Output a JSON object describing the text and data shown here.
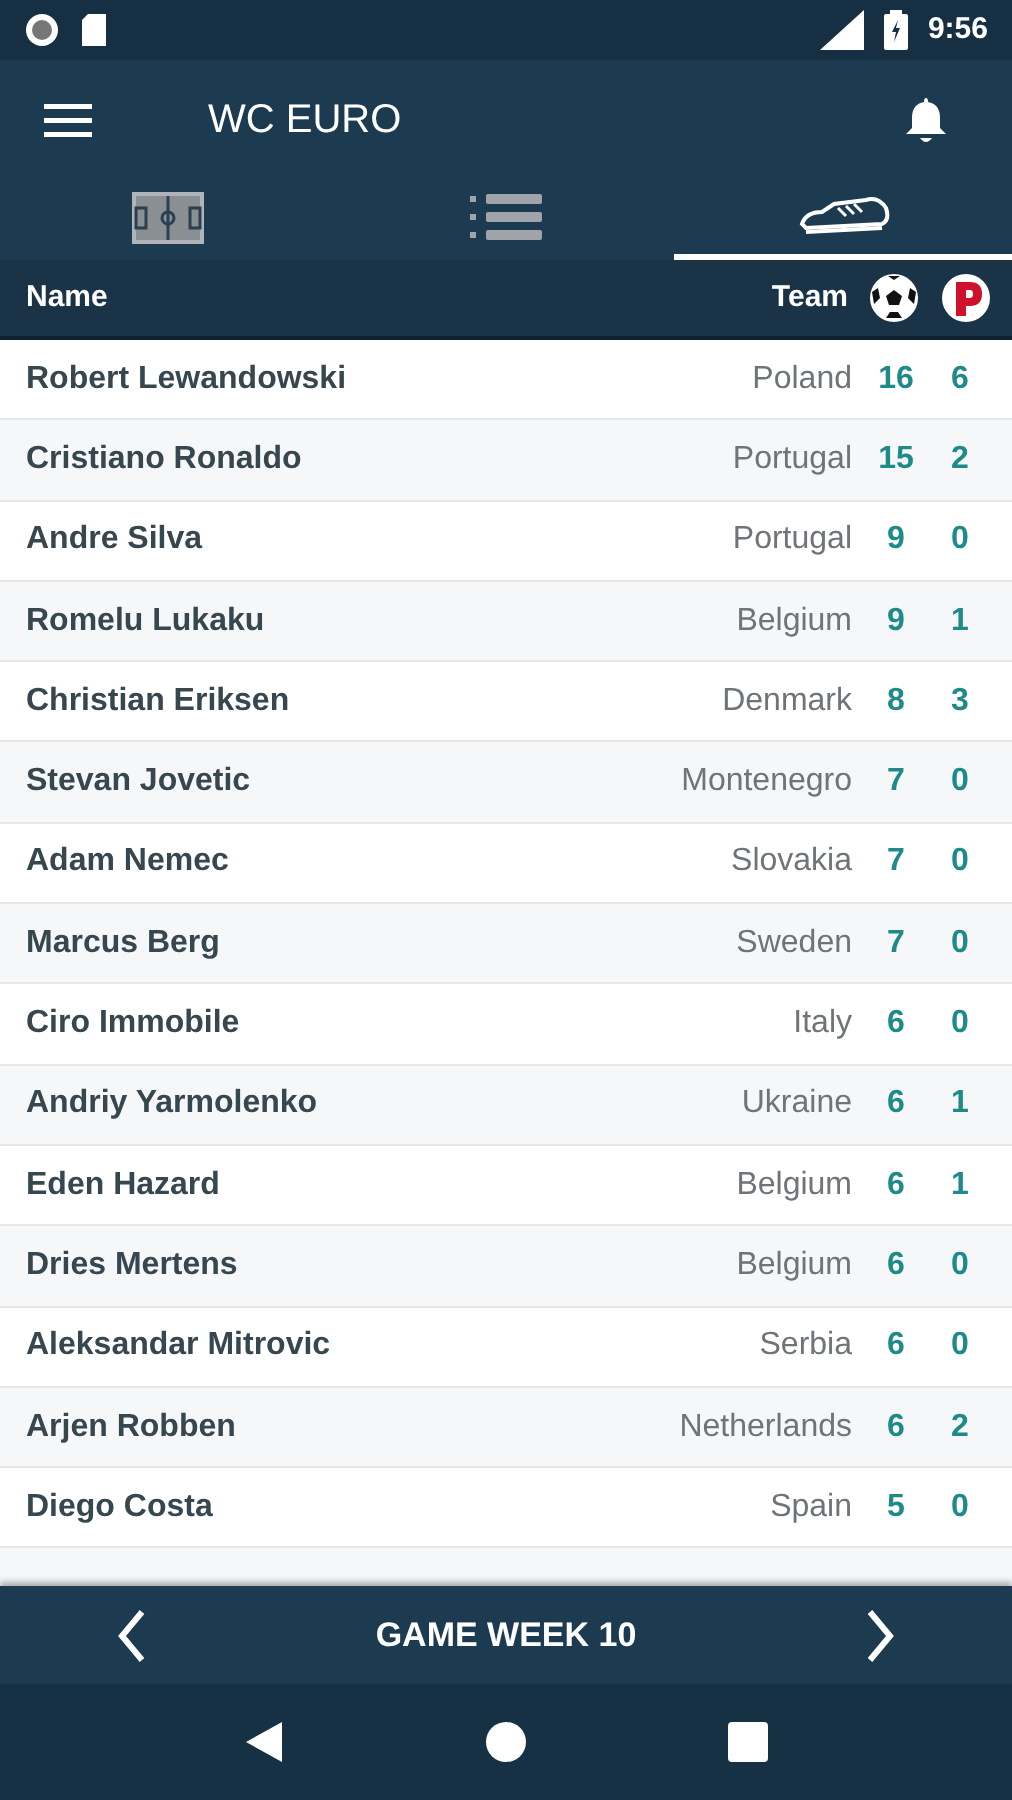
{
  "status_bar": {
    "time": "9:56"
  },
  "app_bar": {
    "title": "WC EURO"
  },
  "tabs": [
    {
      "kind": "pitch",
      "selected": false
    },
    {
      "kind": "list",
      "selected": false
    },
    {
      "kind": "boot",
      "selected": true
    }
  ],
  "table": {
    "columns": [
      "Name",
      "Team"
    ],
    "rows": [
      {
        "name": "Robert Lewandowski",
        "team": "Poland",
        "goals": "16",
        "assists": "6"
      },
      {
        "name": "Cristiano Ronaldo",
        "team": "Portugal",
        "goals": "15",
        "assists": "2"
      },
      {
        "name": "Andre Silva",
        "team": "Portugal",
        "goals": "9",
        "assists": "0"
      },
      {
        "name": "Romelu Lukaku",
        "team": "Belgium",
        "goals": "9",
        "assists": "1"
      },
      {
        "name": "Christian Eriksen",
        "team": "Denmark",
        "goals": "8",
        "assists": "3"
      },
      {
        "name": "Stevan Jovetic",
        "team": "Montenegro",
        "goals": "7",
        "assists": "0"
      },
      {
        "name": "Adam Nemec",
        "team": "Slovakia",
        "goals": "7",
        "assists": "0"
      },
      {
        "name": "Marcus Berg",
        "team": "Sweden",
        "goals": "7",
        "assists": "0"
      },
      {
        "name": "Ciro Immobile",
        "team": "Italy",
        "goals": "6",
        "assists": "0"
      },
      {
        "name": "Andriy Yarmolenko",
        "team": "Ukraine",
        "goals": "6",
        "assists": "1"
      },
      {
        "name": "Eden Hazard",
        "team": "Belgium",
        "goals": "6",
        "assists": "1"
      },
      {
        "name": "Dries Mertens",
        "team": "Belgium",
        "goals": "6",
        "assists": "0"
      },
      {
        "name": "Aleksandar Mitrovic",
        "team": "Serbia",
        "goals": "6",
        "assists": "0"
      },
      {
        "name": "Arjen Robben",
        "team": "Netherlands",
        "goals": "6",
        "assists": "2"
      },
      {
        "name": "Diego Costa",
        "team": "Spain",
        "goals": "5",
        "assists": "0"
      }
    ]
  },
  "footer": {
    "label": "GAME WEEK 10"
  }
}
